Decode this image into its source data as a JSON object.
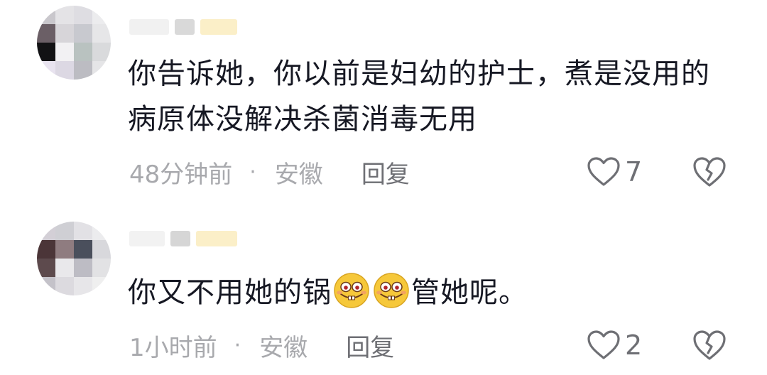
{
  "comments": [
    {
      "text": "你告诉她，你以前是妇幼的护士，煮是没用的病原体没解决杀菌消毒无用",
      "time": "48分钟前",
      "separator": "·",
      "location": "安徽",
      "reply_label": "回复",
      "like_count": "7"
    },
    {
      "text_before": "你又不用她的锅",
      "emojis": [
        "grin-emoji",
        "grin-emoji"
      ],
      "text_after": "管她呢。",
      "time": "1小时前",
      "separator": "·",
      "location": "安徽",
      "reply_label": "回复",
      "like_count": "2"
    }
  ],
  "icons": {
    "like": "heart-outline-icon",
    "dislike": "broken-heart-icon"
  },
  "colors": {
    "text": "#161823",
    "meta": "#a8a9ad",
    "icon": "#6e6f74",
    "background": "#ffffff"
  }
}
